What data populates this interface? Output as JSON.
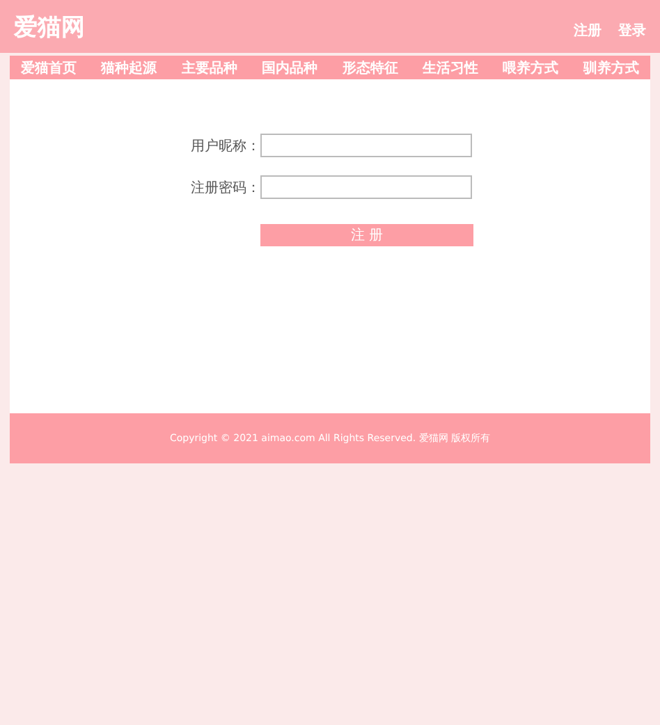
{
  "header": {
    "logo": "爱猫网",
    "links": [
      "注册",
      "登录"
    ]
  },
  "nav": [
    "爱猫首页",
    "猫种起源",
    "主要品种",
    "国内品种",
    "形态特征",
    "生活习性",
    "喂养方式",
    "驯养方式"
  ],
  "form": {
    "fields": [
      {
        "label": "用户昵称："
      },
      {
        "label": "注册密码："
      }
    ],
    "submit": "注 册"
  },
  "footer": "Copyright © 2021 aimao.com All Rights Reserved. 爱猫网 版权所有"
}
